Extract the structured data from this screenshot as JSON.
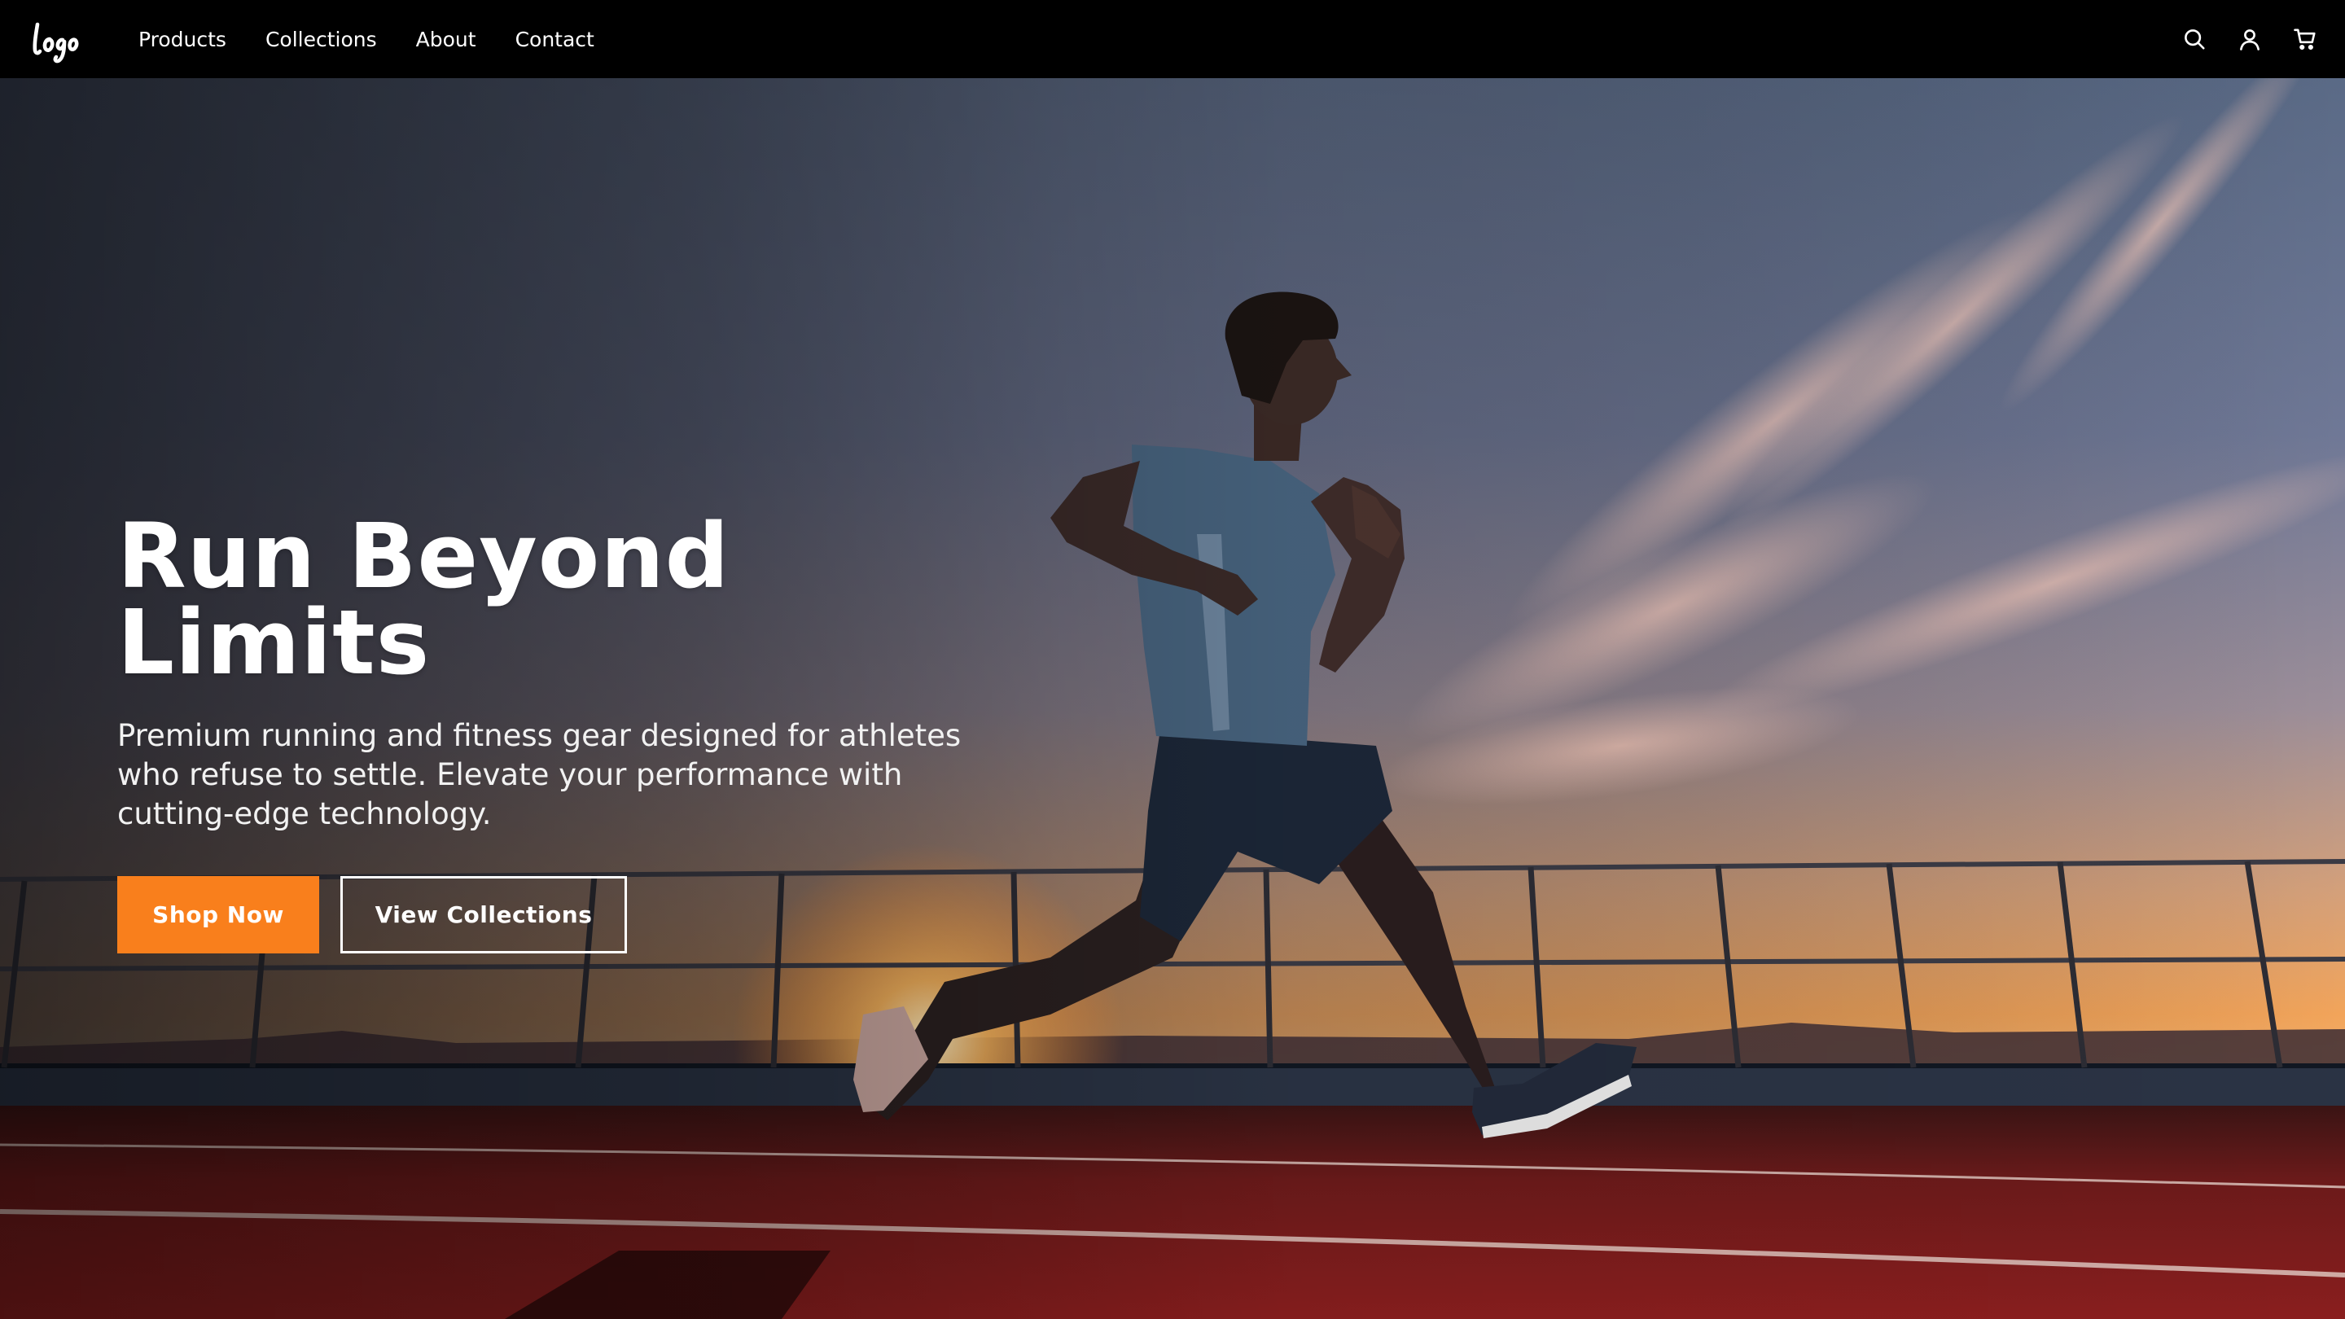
{
  "nav": {
    "links": [
      {
        "label": "Products"
      },
      {
        "label": "Collections"
      },
      {
        "label": "About"
      },
      {
        "label": "Contact"
      }
    ],
    "icons": [
      "search-icon",
      "user-icon",
      "cart-icon"
    ]
  },
  "hero": {
    "title": "Run Beyond Limits",
    "subtitle": "Premium running and fitness gear designed for athletes who refuse to settle. Elevate your performance with cutting-edge technology.",
    "primary_button": "Shop Now",
    "secondary_button": "View Collections"
  },
  "colors": {
    "accent": "#f97f1c",
    "nav_background": "#000000",
    "text": "#ffffff"
  }
}
